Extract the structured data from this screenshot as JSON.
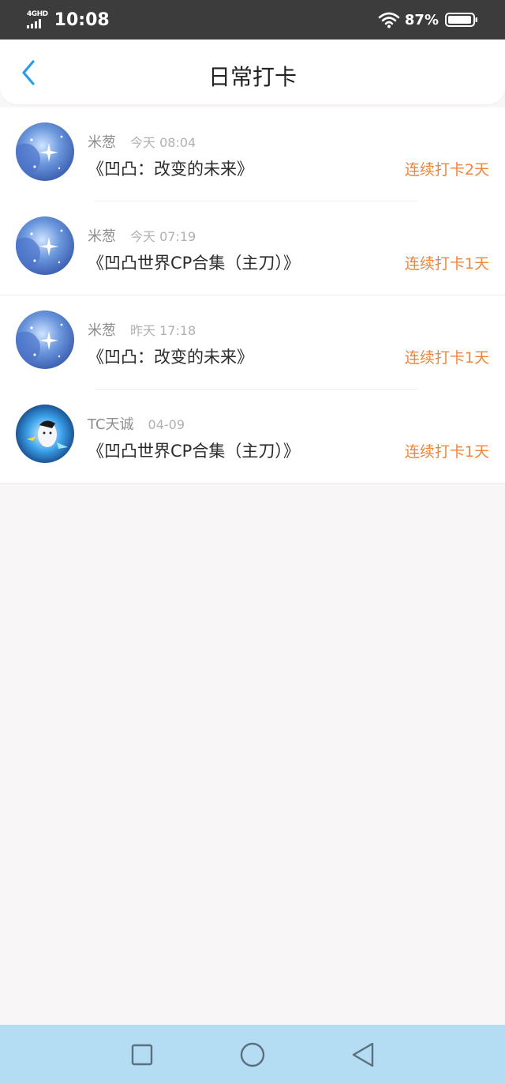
{
  "status_bar": {
    "network": "4GHD",
    "time": "10:08",
    "battery_percent": "87%"
  },
  "header": {
    "title": "日常打卡",
    "back_icon": "chevron-left-icon",
    "accent_color": "#2d9be6"
  },
  "items": [
    {
      "username": "米葱",
      "time": "今天 08:04",
      "book": "《凹凸：改变的未来》",
      "streak": "连续打卡2天",
      "avatar": "starry-blue"
    },
    {
      "username": "米葱",
      "time": "今天 07:19",
      "book": "《凹凸世界CP合集（主刀）》",
      "streak": "连续打卡1天",
      "avatar": "starry-blue"
    },
    {
      "username": "米葱",
      "time": "昨天 17:18",
      "book": "《凹凸：改变的未来》",
      "streak": "连续打卡1天",
      "avatar": "starry-blue"
    },
    {
      "username": "TC天诚",
      "time": "04-09",
      "book": "《凹凸世界CP合集（主刀）》",
      "streak": "连续打卡1天",
      "avatar": "anime-character"
    }
  ],
  "colors": {
    "streak": "#f0843b",
    "nav_bar": "#b4dcf2",
    "status_bar": "#3c3c3c"
  },
  "nav": {
    "recents_icon": "square-icon",
    "home_icon": "circle-icon",
    "back_icon": "triangle-back-icon"
  }
}
